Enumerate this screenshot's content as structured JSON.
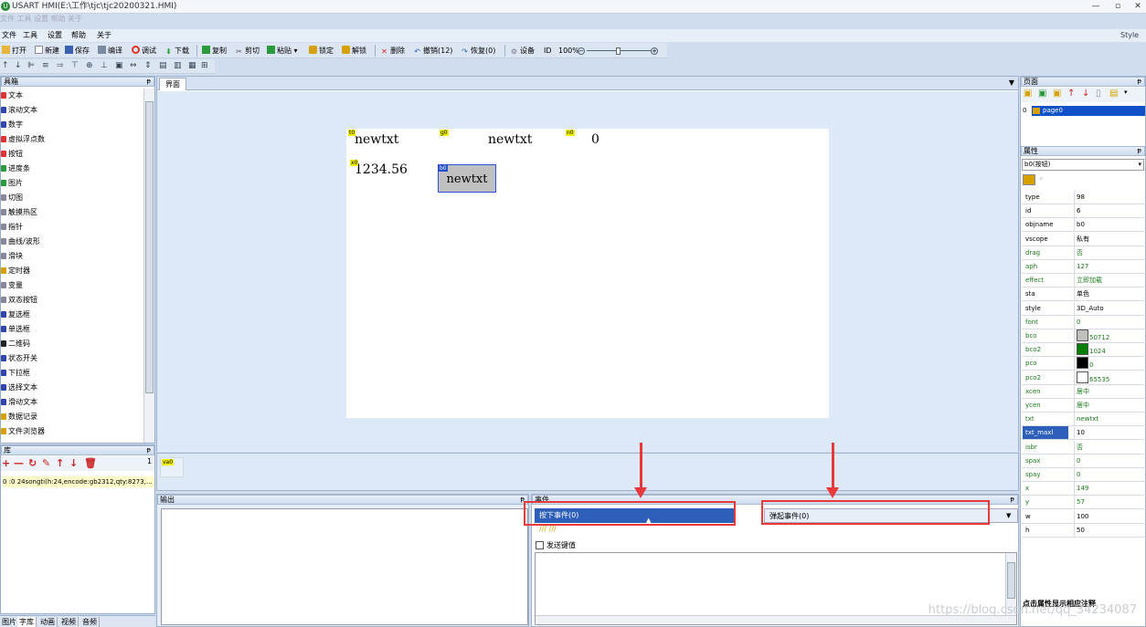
{
  "window": {
    "title": "USART HMI(E:\\工作\\tjc\\tjc20200321.HMI)",
    "ghost_menu": "文件  工具   设置   帮助   关于",
    "min": "—",
    "max": "▫",
    "close": "✕"
  },
  "menu": [
    "文件",
    "工具",
    "设置",
    "帮助",
    "关于"
  ],
  "style_label": "Style",
  "toolbar1": [
    {
      "label": "打开",
      "icon": "open-folder-icon",
      "color": "#e7b33a"
    },
    {
      "label": "新建",
      "icon": "new-file-icon",
      "color": "#ffffff"
    },
    {
      "label": "保存",
      "icon": "save-icon",
      "color": "#3a5fb0"
    },
    {
      "label": "编译",
      "icon": "compile-icon",
      "color": "#7a8aa0"
    },
    {
      "label": "调试",
      "icon": "debug-icon",
      "color": "#d32"
    },
    {
      "label": "下载",
      "icon": "download-icon",
      "color": "#2a9a3a"
    },
    {
      "label": "复制",
      "icon": "copy-icon",
      "color": "#2a9a3a"
    },
    {
      "label": "剪切",
      "icon": "cut-icon",
      "color": "#556"
    },
    {
      "label": "粘贴",
      "icon": "paste-icon",
      "color": "#2a9a3a"
    },
    {
      "label": "锁定",
      "icon": "lock-icon",
      "color": "#d6a000"
    },
    {
      "label": "解锁",
      "icon": "unlock-icon",
      "color": "#d6a000"
    },
    {
      "label": "删除",
      "icon": "delete-icon",
      "color": "#d22"
    },
    {
      "label": "撤销(12)",
      "icon": "undo-icon",
      "color": "#2a5ab0"
    },
    {
      "label": "恢复(0)",
      "icon": "redo-icon",
      "color": "#2a5ab0"
    },
    {
      "label": "设备",
      "icon": "device-gear-icon",
      "color": "#778"
    },
    {
      "label": "ID",
      "icon": "",
      "color": ""
    },
    {
      "label": "100%",
      "icon": "",
      "color": ""
    }
  ],
  "toolbox": {
    "title": "具箱",
    "items": [
      "文本",
      "滚动文本",
      "数字",
      "虚拟浮点数",
      "按钮",
      "进度条",
      "图片",
      "切图",
      "触摸热区",
      "指针",
      "曲线/波形",
      "滑块",
      "定时器",
      "变量",
      "双态按钮",
      "复选框",
      "单选框",
      "二维码",
      "状态开关",
      "下拉框",
      "选择文本",
      "滑动文本",
      "数据记录",
      "文件浏览器"
    ]
  },
  "designer": {
    "tab": "界面",
    "t0_text": "newtxt",
    "t0_tag": "t0",
    "g0_text": "newtxt",
    "g0_tag": "g0",
    "n0_text": "0",
    "n0_tag": "n0",
    "x0_text": "1234.56",
    "x0_tag": "x0",
    "b0_text": "newtxt",
    "b0_tag": "b0"
  },
  "var_tag": "va0",
  "fontlib": {
    "title": "库",
    "count": "1",
    "row": "0 :0    24songti(h:24,encode:gb2312,qty:8273,..."
  },
  "bottom_tabs": [
    "图片",
    "字库",
    "动画",
    "视频",
    "音频"
  ],
  "output": {
    "title": "输出"
  },
  "events": {
    "title": "事件",
    "press": "按下事件(0)",
    "release": "弹起事件(0)",
    "send_key": "发送键值"
  },
  "pages": {
    "title": "页面",
    "items": [
      {
        "index": "0",
        "name": "page0"
      }
    ]
  },
  "properties": {
    "title": "属性",
    "selected": "b0(按钮)",
    "rows": [
      {
        "k": "type",
        "v": "98"
      },
      {
        "k": "id",
        "v": "6"
      },
      {
        "k": "objname",
        "v": "b0"
      },
      {
        "k": "vscope",
        "v": "私有"
      },
      {
        "k": "drag",
        "v": "否",
        "g": true
      },
      {
        "k": "aph",
        "v": "127",
        "g": true
      },
      {
        "k": "effect",
        "v": "立即加载",
        "g": true
      },
      {
        "k": "sta",
        "v": "单色"
      },
      {
        "k": "style",
        "v": "3D_Auto"
      },
      {
        "k": "font",
        "v": "0",
        "g": true
      },
      {
        "k": "bco",
        "v": "50712",
        "g": true,
        "sw": "#c0c0c0"
      },
      {
        "k": "bco2",
        "v": "1024",
        "g": true,
        "sw": "#007f00"
      },
      {
        "k": "pco",
        "v": "0",
        "g": true,
        "sw": "#000000"
      },
      {
        "k": "pco2",
        "v": "65535",
        "g": true,
        "sw": "#ffffff"
      },
      {
        "k": "xcen",
        "v": "居中",
        "g": true
      },
      {
        "k": "ycen",
        "v": "居中",
        "g": true
      },
      {
        "k": "txt",
        "v": "newtxt",
        "g": true
      },
      {
        "k": "txt_maxl",
        "v": "10",
        "sel": true
      },
      {
        "k": "isbr",
        "v": "否",
        "g": true
      },
      {
        "k": "spax",
        "v": "0",
        "g": true
      },
      {
        "k": "spay",
        "v": "0",
        "g": true
      },
      {
        "k": "x",
        "v": "149",
        "g": true
      },
      {
        "k": "y",
        "v": "57",
        "g": true
      },
      {
        "k": "w",
        "v": "100"
      },
      {
        "k": "h",
        "v": "50"
      }
    ],
    "hint": "点击属性显示相应注释"
  },
  "watermark": "https://blog.csdn.net/qq_34234087",
  "colors": {
    "accent": "#2d5fb8",
    "annotation_red": "#e8383c",
    "selection": "#1050c8"
  }
}
